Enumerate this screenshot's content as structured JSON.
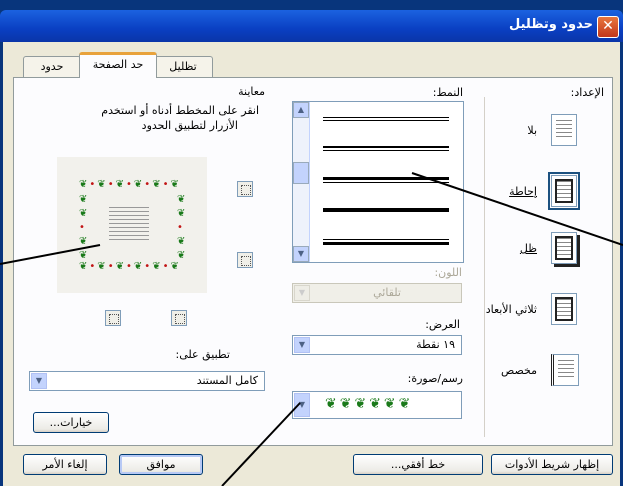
{
  "dialog": {
    "title": "حدود وتظليل"
  },
  "tabs": [
    {
      "label": "تظليل"
    },
    {
      "label": "حد الصفحة"
    },
    {
      "label": "حدود"
    }
  ],
  "setting": {
    "label": "الإعداد:",
    "options": [
      {
        "label": "بلا"
      },
      {
        "label": "إحاطة"
      },
      {
        "label": "ظل"
      },
      {
        "label": "ثلاثي الأبعاد"
      },
      {
        "label": "مخصص"
      }
    ]
  },
  "style": {
    "label": "النمط:"
  },
  "color": {
    "label": "اللون:",
    "value": "تلقائي"
  },
  "width": {
    "label": "العرض:",
    "value": "١٩ نقطة"
  },
  "art": {
    "label": "رسم/صورة:"
  },
  "preview": {
    "label": "معاينة",
    "hint_line1": "انقر على المخطط أدناه أو استخدم",
    "hint_line2": "الأزرار لتطبيق الحدود"
  },
  "apply_to": {
    "label": "تطبيق على:",
    "value": "كامل المستند"
  },
  "buttons": {
    "options": "خيارات...",
    "show_toolbar": "إظهار شريط الأدوات",
    "horizontal_line": "خط أفقي...",
    "ok": "موافق",
    "cancel": "إلغاء الأمر"
  }
}
